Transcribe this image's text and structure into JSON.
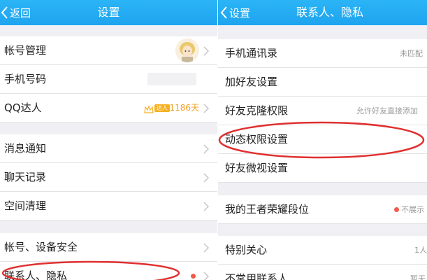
{
  "left": {
    "header": {
      "back_label": "返回",
      "title": "设置"
    },
    "items": [
      {
        "label": "帐号管理"
      },
      {
        "label": "手机号码"
      },
      {
        "label": "QQ达人",
        "badge": "达人",
        "days": "1186天"
      },
      {
        "label": "消息通知"
      },
      {
        "label": "聊天记录"
      },
      {
        "label": "空间清理"
      },
      {
        "label": "帐号、设备安全"
      },
      {
        "label": "联系人、隐私"
      }
    ]
  },
  "right": {
    "header": {
      "back_label": "设置",
      "title": "联系人、隐私"
    },
    "items": [
      {
        "label": "手机通讯录",
        "value": "未匹配"
      },
      {
        "label": "加好友设置",
        "value": ""
      },
      {
        "label": "好友克隆权限",
        "value": "允许好友直接添加"
      },
      {
        "label": "动态权限设置",
        "value": ""
      },
      {
        "label": "好友微视设置",
        "value": ""
      },
      {
        "label": "我的王者荣耀段位",
        "value": "不展示"
      },
      {
        "label": "特别关心",
        "value": "1人"
      },
      {
        "label": "不常用联系人",
        "value": "暂无"
      }
    ]
  },
  "colors": {
    "header_blue": "#1ea4ef",
    "highlight_red": "#e03030",
    "badge_gold": "#f6b021",
    "dot_red": "#f05a4a"
  }
}
